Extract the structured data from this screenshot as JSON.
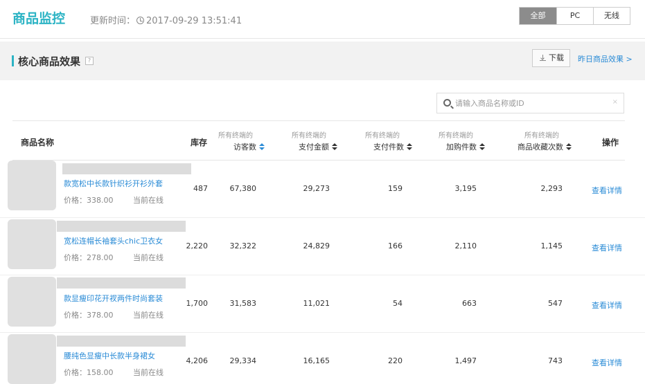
{
  "header": {
    "title": "商品监控",
    "update_label": "更新时间：",
    "update_time": "2017-09-29 13:51:41",
    "segments": [
      "全部",
      "PC",
      "无线"
    ],
    "active_segment": "全部"
  },
  "section": {
    "title": "核心商品效果",
    "help": "?",
    "download_label": "下载",
    "yesterday_link": "昨日商品效果 >"
  },
  "search": {
    "placeholder": "请输入商品名称或ID",
    "clear": "×"
  },
  "table": {
    "columns": {
      "name": "商品名称",
      "stock": "库存",
      "visitors_sub": "所有终端的",
      "visitors": "访客数",
      "pay_amount_sub": "所有终端的",
      "pay_amount": "支付金额",
      "pay_count_sub": "所有终端的",
      "pay_count": "支付件数",
      "cart_sub": "所有终端的",
      "cart": "加购件数",
      "fav_sub": "所有终端的",
      "fav": "商品收藏次数",
      "action": "操作"
    },
    "rows": [
      {
        "name": "款宽松中长款针织衫开衫外套",
        "price": "价格：338.00",
        "status": "当前在线",
        "stock": "487",
        "visitors": "67,380",
        "pay_amount": "29,273",
        "pay_count": "159",
        "cart": "3,195",
        "fav": "2,293",
        "action": "查看详情"
      },
      {
        "name": "宽松连帽长袖套头chic卫衣女",
        "price": "价格：278.00",
        "status": "当前在线",
        "stock": "2,220",
        "visitors": "32,322",
        "pay_amount": "24,829",
        "pay_count": "166",
        "cart": "2,110",
        "fav": "1,145",
        "action": "查看详情"
      },
      {
        "name": "款显瘦印花开衩两件时尚套装",
        "price": "价格：378.00",
        "status": "当前在线",
        "stock": "1,700",
        "visitors": "31,583",
        "pay_amount": "11,021",
        "pay_count": "54",
        "cart": "663",
        "fav": "547",
        "action": "查看详情"
      },
      {
        "name": "腰纯色显瘦中长款半身裙女",
        "price": "价格：158.00",
        "status": "当前在线",
        "stock": "4,206",
        "visitors": "29,334",
        "pay_amount": "16,165",
        "pay_count": "220",
        "cart": "1,497",
        "fav": "743",
        "action": "查看详情"
      }
    ]
  }
}
